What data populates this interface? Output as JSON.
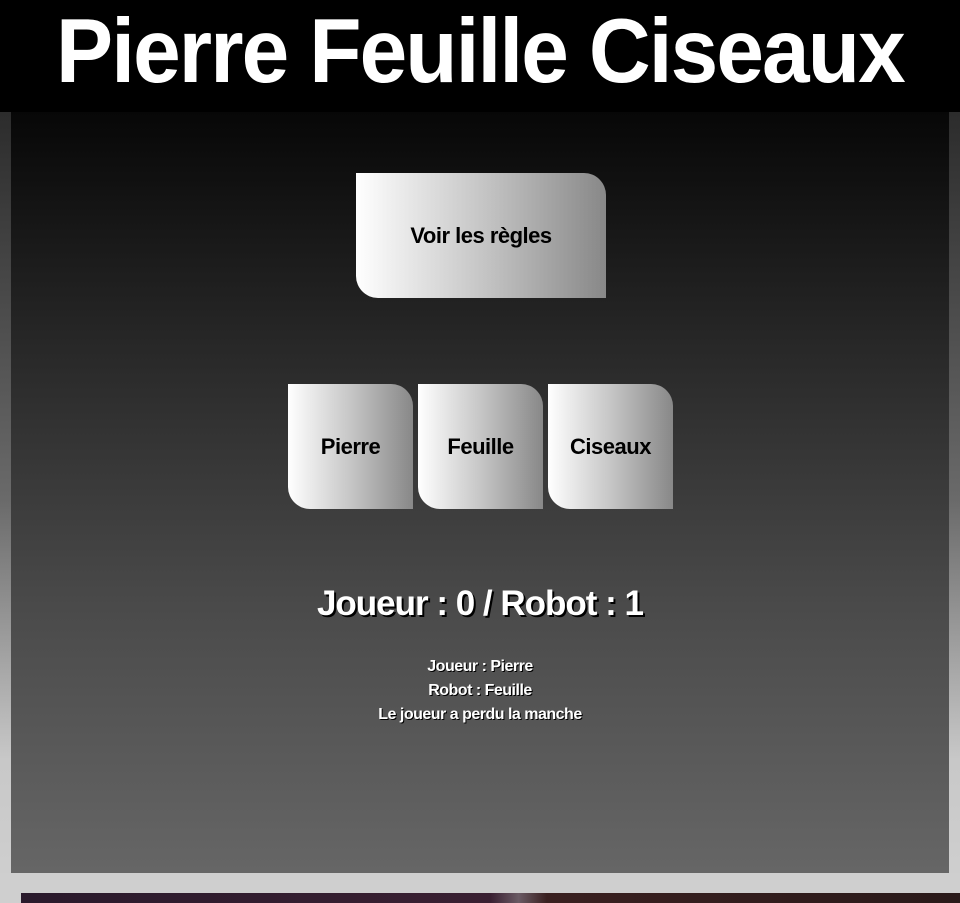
{
  "header": {
    "title": "Pierre Feuille Ciseaux"
  },
  "controls": {
    "rules_label": "Voir les règles",
    "choices": [
      "Pierre",
      "Feuille",
      "Ciseaux"
    ]
  },
  "score": {
    "text": "Joueur : 0 / Robot : 1"
  },
  "round": {
    "player_choice": "Joueur : Pierre",
    "robot_choice": "Robot : Feuille",
    "outcome": "Le joueur a perdu la manche"
  },
  "colors": {
    "header_bg": "#000000",
    "button_gradient_start": "#ffffff",
    "button_gradient_end": "#888888",
    "text": "#ffffff"
  }
}
